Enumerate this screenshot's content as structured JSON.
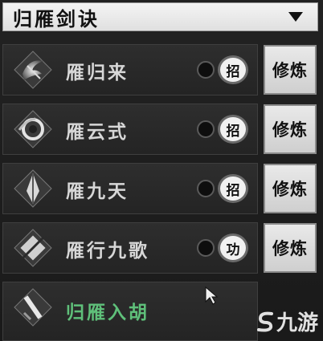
{
  "header": {
    "title": "归雁剑诀",
    "dropdown_icon": "triangle-down-icon"
  },
  "skills": [
    {
      "name": "雁归来",
      "badge": "招",
      "button": "修炼",
      "icon": "sword-swirl-icon",
      "active": false
    },
    {
      "name": "雁云式",
      "badge": "招",
      "button": "修炼",
      "icon": "cloud-swirl-icon",
      "active": false
    },
    {
      "name": "雁九天",
      "badge": "招",
      "button": "修炼",
      "icon": "blade-icon",
      "active": false
    },
    {
      "name": "雁行九歌",
      "badge": "功",
      "button": "修炼",
      "icon": "diamond-sword-icon",
      "active": false
    },
    {
      "name": "归雁入胡",
      "badge": "",
      "button": "",
      "icon": "slash-icon",
      "active": true
    }
  ],
  "watermark": {
    "text": "九游"
  },
  "colors": {
    "active_name": "#5fc07a",
    "inactive_name": "#d7d7d7",
    "background": "#1c1c1c"
  }
}
